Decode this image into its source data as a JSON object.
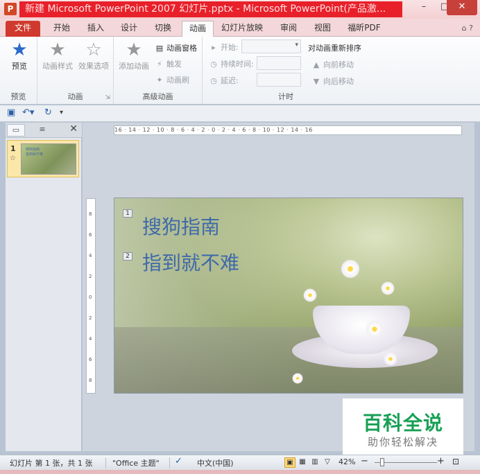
{
  "window": {
    "title": "新建 Microsoft PowerPoint 2007 幻灯片.pptx - Microsoft PowerPoint(产品激...",
    "app_icon": "P",
    "minimize": "–",
    "maximize": "□",
    "close": "✕"
  },
  "tabs": [
    {
      "label": "文件"
    },
    {
      "label": "开始"
    },
    {
      "label": "插入"
    },
    {
      "label": "设计"
    },
    {
      "label": "切换"
    },
    {
      "label": "动画"
    },
    {
      "label": "幻灯片放映"
    },
    {
      "label": "审阅"
    },
    {
      "label": "视图"
    },
    {
      "label": "福昕PDF"
    }
  ],
  "active_tab": "动画",
  "help_icons": "⌂ ?",
  "ribbon": {
    "preview_group": {
      "button": "预览",
      "label": "预览"
    },
    "animation_group": {
      "style_button": "动画样式",
      "options_button": "效果选项",
      "label": "动画"
    },
    "advanced_group": {
      "add_button": "添加动画",
      "pane": "动画窗格",
      "trigger": "触发",
      "painter": "动画刷",
      "label": "高级动画"
    },
    "timing_group": {
      "start_label": "开始:",
      "duration_label": "持续时间:",
      "delay_label": "延迟:",
      "reorder_title": "对动画重新排序",
      "move_earlier": "向前移动",
      "move_later": "向后移动",
      "label": "计时"
    }
  },
  "qat": {
    "save_icon": "save-icon",
    "undo_icon": "undo-icon",
    "redo_icon": "redo-icon"
  },
  "slide_panel": {
    "thumb_number": "1",
    "thumb_star": "☆",
    "thumb_line1": "搜狗指南",
    "thumb_line2": "指到就不难"
  },
  "ruler": {
    "horizontal": "16 · 14 · 12 · 10 · 8 · 6 · 4 · 2 · 0 · 2 · 4 · 6 · 8 · 10 · 12 · 14 · 16",
    "vertical": [
      "8",
      "6",
      "4",
      "2",
      "0",
      "2",
      "4",
      "6",
      "8"
    ]
  },
  "slide": {
    "badge1": "1",
    "badge2": "2",
    "line1": "搜狗指南",
    "line2": "指到就不难"
  },
  "watermark": {
    "main": "百科全说",
    "sub": "助你轻松解决"
  },
  "statusbar": {
    "slide_info": "幻灯片 第 1 张，共 1 张",
    "theme": "\"Office 主题\"",
    "language": "中文(中国)",
    "zoom": "42%",
    "zoom_out": "−",
    "zoom_in": "+"
  },
  "colors": {
    "accent": "#d03a2e",
    "title_bar": "#e8202a",
    "slide_text": "#3f6aa8",
    "watermark": "#17a055"
  }
}
